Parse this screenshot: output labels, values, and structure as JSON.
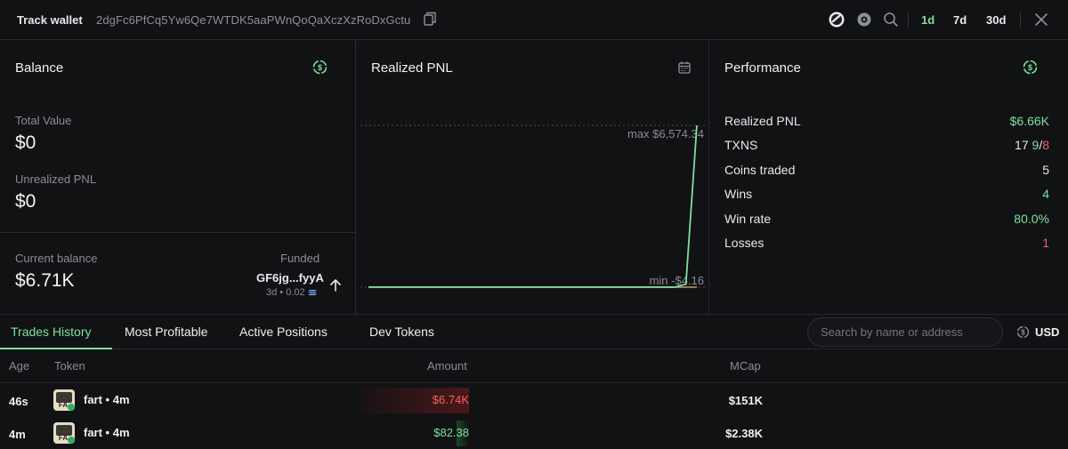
{
  "topbar": {
    "title": "Track wallet",
    "address": "2dgFc6PfCq5Yw6Qe7WTDK5aaPWnQoQaXczXzRoDxGctu",
    "periods": [
      "1d",
      "7d",
      "30d"
    ],
    "active_period": "1d"
  },
  "balance": {
    "title": "Balance",
    "total_value_label": "Total Value",
    "total_value": "$0",
    "unrealized_label": "Unrealized PNL",
    "unrealized_value": "$0",
    "current_label": "Current balance",
    "current_value": "$6.71K",
    "funded_label": "Funded",
    "funded_address": "GF6jg...fyyA",
    "funded_meta": "3d • 0.02"
  },
  "realized_pnl": {
    "title": "Realized PNL",
    "max_label": "max $6,574.34",
    "min_label": "min -$4.16"
  },
  "chart_data": {
    "type": "line",
    "title": "Realized PNL",
    "xlabel": "",
    "ylabel": "",
    "series": [
      {
        "values": [
          0,
          0,
          0,
          0,
          0,
          0,
          0,
          0,
          0,
          0,
          -4.16,
          120,
          6574.34
        ]
      }
    ],
    "max": 6574.34,
    "min": -4.16,
    "line_color": "#7ee0a0",
    "baseline_color": "#c49a6c"
  },
  "performance": {
    "title": "Performance",
    "rows": [
      {
        "label": "Realized PNL",
        "value": "$6.66K"
      },
      {
        "label": "TXNS",
        "total": "17",
        "buys": "9",
        "sep": "/",
        "sells": "8"
      },
      {
        "label": "Coins traded",
        "value": "5"
      },
      {
        "label": "Wins",
        "value": "4"
      },
      {
        "label": "Win rate",
        "value": "80.0%"
      },
      {
        "label": "Losses",
        "value": "1"
      }
    ]
  },
  "tabs": {
    "items": [
      "Trades History",
      "Most Profitable",
      "Active Positions",
      "Dev Tokens"
    ],
    "active": "Trades History",
    "search_placeholder": "Search by name or address",
    "currency": "USD"
  },
  "table": {
    "columns": [
      "Age",
      "Token",
      "Amount",
      "MCap"
    ],
    "rows": [
      {
        "age": "46s",
        "token": "fart • 4m",
        "amount": "$6.74K",
        "amount_type": "sell",
        "amount_fill": 0.9,
        "mcap": "$151K"
      },
      {
        "age": "4m",
        "token": "fart • 4m",
        "amount": "$82.38",
        "amount_type": "buy",
        "amount_fill": 0.1,
        "mcap": "$2.38K"
      }
    ]
  },
  "colors": {
    "accent": "#7ee0a0",
    "negative": "#f0645c",
    "background": "#111214"
  }
}
